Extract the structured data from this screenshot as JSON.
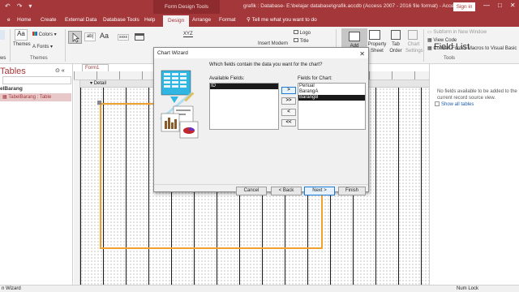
{
  "titlebar": {
    "context_tools": "Form Design Tools",
    "title": "grafik : Database- E:\\belajar database\\grafik.accdb (Access 2007 - 2016 file format) - Access",
    "signin": "Sign in",
    "qat": [
      "↶",
      "↷",
      "▾"
    ],
    "window_buttons": [
      "—",
      "□",
      "✕"
    ]
  },
  "tabs": [
    {
      "label": "Home"
    },
    {
      "label": "Create"
    },
    {
      "label": "External Data"
    },
    {
      "label": "Database Tools"
    },
    {
      "label": "Help"
    },
    {
      "label": "Design"
    },
    {
      "label": "Arrange"
    },
    {
      "label": "Format"
    }
  ],
  "tellme": "Tell me what you want to do",
  "ribbon": {
    "themes_label": "Themes",
    "colors_label": "Colors",
    "fonts_label": "Fonts",
    "group_themes": "Themes",
    "ab_label": "ab|",
    "xyz_label": "XYZ",
    "insert_modern": "Insert Modern",
    "logo": "Logo",
    "title": "Title",
    "add_existing": "Add Existing",
    "property_sheet": "Property Sheet",
    "tab_order": "Tab Order",
    "chart_settings": "Chart Settings",
    "subform_new_window": "Subform in New Window",
    "view_code": "View Code",
    "convert_macros": "Convert Form's Macros to Visual Basic",
    "group_tools": "Tools",
    "group_left": "ws"
  },
  "nav": {
    "title": "Tables",
    "header": "elBarang",
    "item": "TabelBarang : Table"
  },
  "workspace": {
    "doc_tab": "Form1",
    "section": "Detail"
  },
  "fieldlist": {
    "title": "Field List",
    "message": "No fields available to be added to the current record source view.",
    "link": "Show all tables"
  },
  "statusbar": {
    "left": "n Wizard",
    "right": "Num Lock"
  },
  "dialog": {
    "title": "Chart Wizard",
    "prompt": "Which fields contain the data you want for the chart?",
    "available_label": "Available Fields:",
    "chart_label": "Fields for Chart:",
    "available_fields": [
      "ID"
    ],
    "chart_fields": [
      "Periual",
      "BarangA",
      "BarangB"
    ],
    "move_one": ">",
    "move_all": ">>",
    "remove_one": "<",
    "remove_all": "<<",
    "cancel": "Cancel",
    "back": "< Back",
    "next": "Next >",
    "finish": "Finish"
  },
  "colors": {
    "brand": "#a4373a",
    "selection": "#1a1a1a",
    "focus": "#1e7bd4",
    "control_border": "#f0a030"
  }
}
